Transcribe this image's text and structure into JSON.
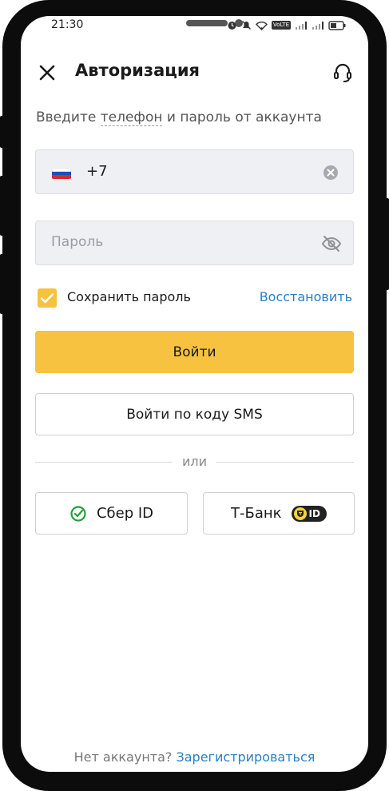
{
  "status_bar": {
    "time": "21:30",
    "icons": [
      "alarm-icon",
      "mute-icon",
      "wifi-icon",
      "volte-icon",
      "signal-icon",
      "signal-icon",
      "battery-icon"
    ],
    "volte_label": "VoLTE"
  },
  "header": {
    "title": "Авторизация",
    "close_icon": "close-icon",
    "support_icon": "headset-icon"
  },
  "subtitle": {
    "before": "Введите ",
    "underlined": "телефон",
    "after": " и пароль от аккаунта"
  },
  "phone_field": {
    "country_flag": "russia-flag-icon",
    "value": "+7",
    "clear_icon": "clear-icon"
  },
  "password_field": {
    "placeholder": "Пароль",
    "toggle_icon": "eye-off-icon"
  },
  "remember": {
    "checked": true,
    "label": "Сохранить пароль",
    "restore_link": "Восстановить"
  },
  "buttons": {
    "login": "Войти",
    "sms_login": "Войти по коду SMS"
  },
  "divider_text": "или",
  "alt_logins": {
    "sber": {
      "label": "Сбер ID",
      "icon": "sber-check-icon",
      "color": "#21a038"
    },
    "tbank": {
      "label": "Т-Банк",
      "badge": "ID",
      "icon": "tbank-shield-icon"
    }
  },
  "footer": {
    "question": "Нет аккаунта?",
    "register_link": "Зарегистрироваться"
  },
  "colors": {
    "accent_yellow": "#f7c240",
    "link_blue": "#2a7fc6",
    "field_bg": "#eff0f3"
  }
}
